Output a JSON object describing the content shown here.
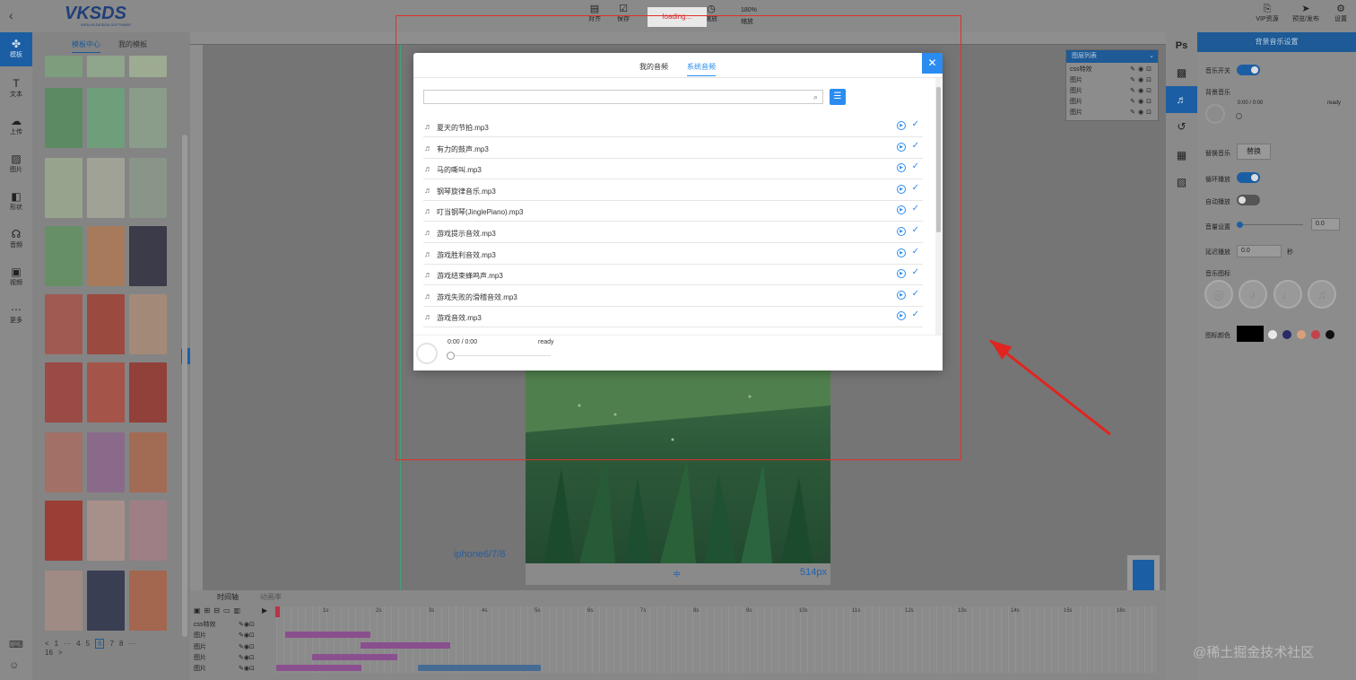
{
  "topbar": {
    "logo": "VKSDS",
    "logo_sub": "WEB-H5-DESIGN-SOFTWARE",
    "tools": [
      {
        "icon": "align-icon",
        "label": "对齐"
      },
      {
        "icon": "save-icon",
        "label": "保存"
      },
      {
        "icon": "history-icon",
        "label": "历史"
      },
      {
        "icon": "zoom-icon",
        "label": "缩放"
      }
    ],
    "loading_text": "loading...",
    "zoom_value": "180%",
    "right_tools": [
      {
        "icon": "vip-icon",
        "label": "VIP资源"
      },
      {
        "icon": "publish-icon",
        "label": "预览/发布"
      },
      {
        "icon": "settings-icon",
        "label": "设置"
      }
    ]
  },
  "rail": {
    "items": [
      {
        "icon": "template-icon",
        "label": "模板"
      },
      {
        "icon": "text-icon",
        "label": "文本"
      },
      {
        "icon": "upload-icon",
        "label": "上传"
      },
      {
        "icon": "image-icon",
        "label": "图片"
      },
      {
        "icon": "shape-icon",
        "label": "形状"
      },
      {
        "icon": "audio-icon",
        "label": "音频"
      },
      {
        "icon": "video-icon",
        "label": "视频"
      },
      {
        "icon": "more-icon",
        "label": "更多"
      }
    ]
  },
  "templates": {
    "tabs": [
      "模板中心",
      "我的模板"
    ],
    "pager": [
      "<",
      "1",
      "···",
      "4",
      "5",
      "6",
      "7",
      "8",
      "···",
      "16",
      ">"
    ],
    "current_page": "6"
  },
  "canvas": {
    "device_label": "iphone6/7/8",
    "height_label": "514px"
  },
  "layers": {
    "title": "图层列表",
    "rows": [
      "css特效",
      "图片",
      "图片",
      "图片",
      "图片"
    ]
  },
  "right_rail": [
    "Ps",
    "texture-icon",
    "music-icon",
    "history-icon",
    "grid-icon",
    "picture-icon"
  ],
  "music_settings": {
    "title": "背景音乐设置",
    "music_switch_label": "音乐开关",
    "bg_music_label": "背景音乐",
    "time": "0:00 / 0:00",
    "status": "ready",
    "replace_label": "替换音乐",
    "replace_button": "替换",
    "loop_label": "循环播放",
    "autoplay_label": "自动播放",
    "volume_label": "音量设置",
    "volume_value": "0.0",
    "delay_label": "延迟播放",
    "delay_value": "0.0",
    "delay_unit": "秒",
    "icon_label": "音乐图标",
    "icon_color_label": "图标颜色",
    "swatch_colors": [
      "#000000",
      "#e8e8e8",
      "#2a2a6a",
      "#d7a07a",
      "#c4424a",
      "#111111"
    ]
  },
  "timeline": {
    "tabs": [
      "时间轴",
      "动画率"
    ],
    "rows": [
      "css特效",
      "图片",
      "图片",
      "图片",
      "图片"
    ],
    "ticks": [
      "1s",
      "2s",
      "3s",
      "4s",
      "5s",
      "6s",
      "7s",
      "8s",
      "9s",
      "10s",
      "11s",
      "12s",
      "13s",
      "14s",
      "15s",
      "16s"
    ]
  },
  "dialog": {
    "tabs": [
      "我的音频",
      "系统音频"
    ],
    "active_tab": "系统音频",
    "search_placeholder": "",
    "tracks": [
      "夏天的节拍.mp3",
      "有力的鼓声.mp3",
      "马的嘶叫.mp3",
      "钢琴旋律音乐.mp3",
      "叮当钢琴(JinglePiano).mp3",
      "游戏提示音效.mp3",
      "游戏胜利音效.mp3",
      "游戏结束蜂鸣声.mp3",
      "游戏失败的滑稽音效.mp3",
      "游戏音效.mp3"
    ],
    "player_time": "0:00 / 0:00",
    "player_status": "ready"
  },
  "watermark": "@稀土掘金技术社区",
  "colors": {
    "accent": "#2a8cf0",
    "annotation_red": "#e0302a"
  }
}
